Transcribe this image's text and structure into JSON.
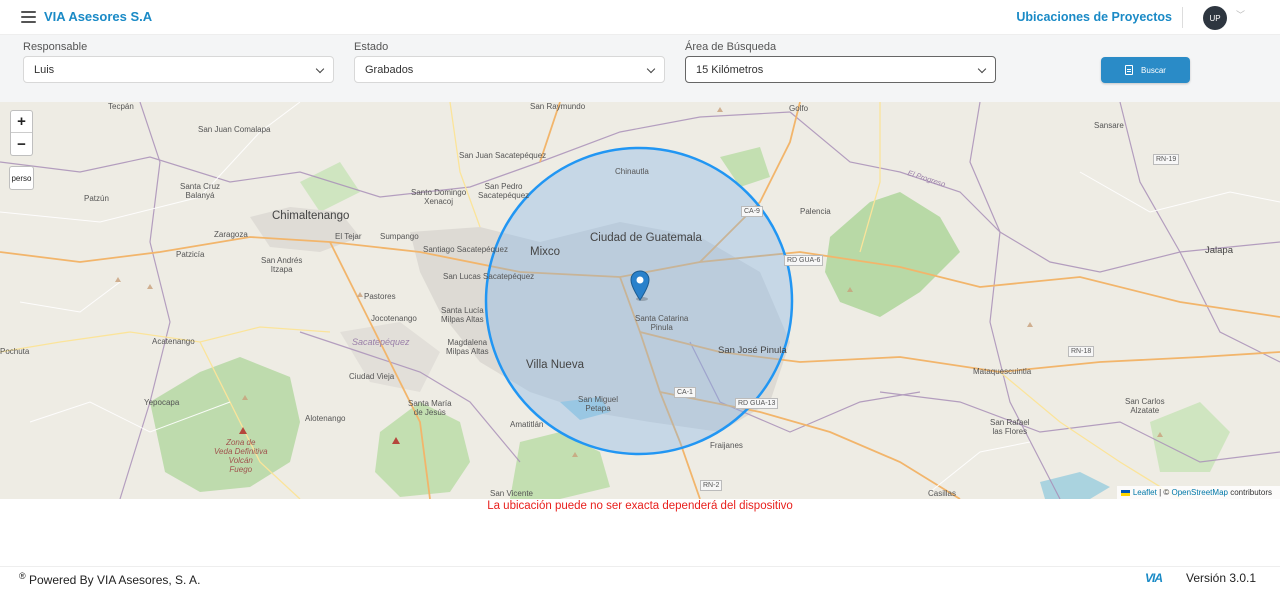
{
  "header": {
    "brand": "VIA Asesores S.A",
    "title": "Ubicaciones de Proyectos",
    "avatar_initials": "UP"
  },
  "filters": {
    "responsable": {
      "label": "Responsable",
      "value": "Luis"
    },
    "estado": {
      "label": "Estado",
      "value": "Grabados"
    },
    "area": {
      "label": "Área de Búsqueda",
      "value": "15 Kilómetros"
    },
    "search_label": "Buscar"
  },
  "map": {
    "zoom_in": "+",
    "zoom_out": "−",
    "custom_control": "perso",
    "labels": {
      "tecpan": "Tecpán",
      "san_juan_comalapa": "San Juan Comalapa",
      "santa_cruz_balanya": "Santa Cruz\nBalanyá",
      "patzun": "Patzún",
      "chimaltenango": "Chimaltenango",
      "zaragoza": "Zaragoza",
      "el_tejar": "El Tejar",
      "sumpango": "Sumpango",
      "patzicia": "Patzicía",
      "san_andres_itzapa": "San Andrés\nItzapa",
      "san_juan_sacatepequez": "San Juan Sacatepéquez",
      "santo_domingo_xenacoj": "Santo Domingo\nXenacoj",
      "san_pedro_sacatepequez": "San Pedro\nSacatepéquez",
      "san_raymundo": "San Raymundo",
      "santiago_sacatepequez": "Santiago Sacatepéquez",
      "san_lucas_sacatepequez": "San Lucas Sacatepéquez",
      "pastores": "Pastores",
      "jocotenango": "Jocotenango",
      "santa_lucia_milpas_altas": "Santa Lucía\nMilpas Altas",
      "sacatepequez": "Sacatepéquez",
      "magdalena_milpas_altas": "Magdalena\nMilpas Altas",
      "acatenango": "Acatenango",
      "ciudad_vieja": "Ciudad Vieja",
      "pochuta": "Pochuta",
      "yepocapa": "Yepocapa",
      "alotenango": "Alotenango",
      "santa_maria_de_jesus": "Santa María\nde Jesús",
      "zona_veda": "Zona de\nVeda Definitiva\nVolcán\nFuego",
      "mixco": "Mixco",
      "ciudad_de_guatemala": "Ciudad de Guatemala",
      "chinautla": "Chinautla",
      "santa_catarina_pinula": "Santa Catarina\nPinula",
      "villa_nueva": "Villa Nueva",
      "san_miguel_petapa": "San Miguel\nPetapa",
      "amatitlan": "Amatitlán",
      "san_vicente": "San Vicente",
      "fraijanes": "Fraijanes",
      "san_jose_pinula": "San José Pinula",
      "golfo": "Golfo",
      "palencia": "Palencia",
      "el_progreso": "El Progreso",
      "sansare": "Sansare",
      "jalapa": "Jalapa",
      "mataquescuintla": "Mataquescuintla",
      "san_carlos_alzatate": "San Carlos\nAlzatate",
      "san_rafael_las_flores": "San Rafael\nlas Flores",
      "casillas": "Casillas",
      "ca1": "CA-1",
      "ca9": "CA-9",
      "rn19": "RN-19",
      "rn18": "RN-18",
      "rn2": "RN-2",
      "rd_gua6": "RD GUA-6",
      "rd_gua13": "RD GUA-13"
    },
    "attribution": {
      "leaflet": "Leaflet",
      "sep": " | © ",
      "osm": "OpenStreetMap",
      "contributors": " contributors"
    }
  },
  "warning": "La ubicación puede no ser exacta dependerá del dispositivo",
  "footer": {
    "powered_symbol": "®",
    "powered": " Powered By VIA Asesores, S. A.",
    "logo": "VIA",
    "version": "Versión 3.0.1"
  },
  "colors": {
    "brand": "#1a8ac6",
    "button": "#2a8bc7",
    "warning": "#e8201d",
    "radius_circle": "#2196f3",
    "forest": "#b2d6a2",
    "urban": "#dcdcdc"
  }
}
